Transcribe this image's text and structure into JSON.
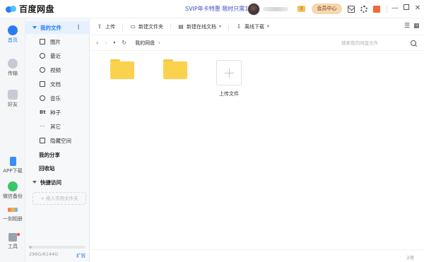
{
  "titlebar": {
    "app_name": "百度网盘",
    "promo": "SVIP年卡特惠 限时只需1.6",
    "vip_level": "3",
    "member_center": "会员中心",
    "icons": [
      "mail-icon",
      "gear-icon",
      "gift-icon",
      "minimize-icon",
      "maximize-icon",
      "close-icon"
    ]
  },
  "rail": {
    "items": [
      {
        "label": "首页",
        "icon": "home-icon",
        "active": true
      },
      {
        "label": "传输",
        "icon": "transfer-icon"
      },
      {
        "label": "好友",
        "icon": "friends-icon"
      },
      {
        "label": "APP下载",
        "icon": "phone-icon"
      },
      {
        "label": "微信备份",
        "icon": "wechat-icon"
      },
      {
        "label": "一刻相册",
        "icon": "album-icon"
      },
      {
        "label": "工具",
        "icon": "tools-icon"
      }
    ]
  },
  "sidebar": {
    "my_files": "我的文件",
    "more": "⋮",
    "categories": [
      {
        "label": "图片",
        "icon": "image-icon"
      },
      {
        "label": "最近",
        "icon": "clock-icon"
      },
      {
        "label": "视频",
        "icon": "video-icon"
      },
      {
        "label": "文档",
        "icon": "document-icon"
      },
      {
        "label": "音乐",
        "icon": "music-icon"
      },
      {
        "label": "种子",
        "icon": "bt-icon",
        "glyph": "Bt"
      },
      {
        "label": "其它",
        "icon": "other-icon",
        "glyph": "···"
      },
      {
        "label": "隐藏空间",
        "icon": "lock-icon"
      }
    ],
    "my_share": "我的分享",
    "recycle": "回收站",
    "quick_access": "快捷访问",
    "add_common": "+ 拖入常用文件夹",
    "storage": {
      "used_text": "299G/6144G",
      "used_fraction": 0.049,
      "expand": "扩容"
    }
  },
  "toolbar": {
    "upload": "上传",
    "new_folder": "新建文件夹",
    "new_online_doc": "新建在线文档",
    "offline_download": "离线下载"
  },
  "path": {
    "breadcrumb": "我的网盘",
    "search_placeholder": "搜索我的网盘文件"
  },
  "files": {
    "items": [
      {
        "type": "folder",
        "name": ""
      },
      {
        "type": "folder",
        "name": ""
      }
    ],
    "upload_label": "上传文件"
  },
  "status": {
    "count": "2项"
  },
  "colors": {
    "accent": "#2a7cf6",
    "folder": "#fbd24e",
    "member_button": "#f6d7b0",
    "sidebar_active": "#e6f0ff"
  }
}
